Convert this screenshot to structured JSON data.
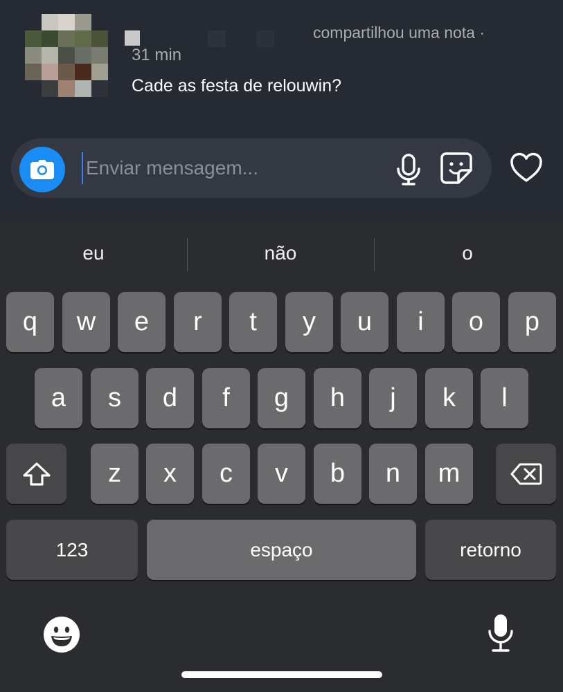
{
  "note": {
    "shared_text": "compartilhou uma nota ·",
    "timestamp": "31 min",
    "text": "Cade as festa de relouwin?"
  },
  "composer": {
    "placeholder": "Enviar mensagem...",
    "camera_icon": "camera-icon",
    "mic_icon": "microphone-icon",
    "sticker_icon": "sticker-icon",
    "heart_icon": "heart-icon",
    "accent_color": "#1a8cf5"
  },
  "keyboard": {
    "suggestions": [
      "eu",
      "não",
      "o"
    ],
    "row1": [
      "q",
      "w",
      "e",
      "r",
      "t",
      "y",
      "u",
      "i",
      "o",
      "p"
    ],
    "row2": [
      "a",
      "s",
      "d",
      "f",
      "g",
      "h",
      "j",
      "k",
      "l"
    ],
    "row3": [
      "z",
      "x",
      "c",
      "v",
      "b",
      "n",
      "m"
    ],
    "shift_icon": "shift-icon",
    "delete_icon": "backspace-icon",
    "numbers_label": "123",
    "space_label": "espaço",
    "return_label": "retorno",
    "emoji_icon": "emoji-icon",
    "dictation_icon": "microphone-icon"
  }
}
